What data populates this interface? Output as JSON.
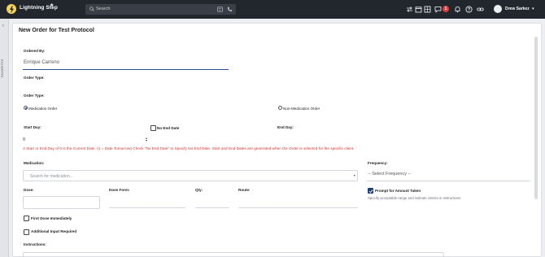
{
  "header": {
    "brand": "Lightning Step",
    "search_placeholder": "Search",
    "notification_count": "1",
    "user_name": "Drew Sarkez"
  },
  "sidebar": {
    "vertical_label": "FAVORITES"
  },
  "form": {
    "title": "New Order for Test Protocol",
    "ordered_by_label": "Ordered By:",
    "ordered_by_value": "Enrique Carreno",
    "order_type_label_1": "Order Type:",
    "order_type_label_2": "Order Type:",
    "order_type_options": [
      "Medication Order",
      "Non-Medication Order"
    ],
    "order_type_selected": "Medication Order",
    "start_day_label": "Start Day:",
    "start_day_value": "0",
    "no_end_date_label": "No End Date",
    "no_end_date_checked": false,
    "end_day_label": "End Day:",
    "warning": "A Start or End Day of 0 is the Current Date. (1 = Date Tomorrow) Check \"No End Date\" to Specify No End Date. Start and End Dates are generated when the Order is selected for the specific client.",
    "medication_label": "Medication:",
    "medication_placeholder": "Search for medication...",
    "frequency_label": "Frequency:",
    "frequency_value": "-- Select Frequency --",
    "dose_label": "Dose:",
    "dose_form_label": "Dose Form:",
    "qty_label": "Qty:",
    "route_label": "Route:",
    "prompt_amount_label": "Prompt for Amount Taken",
    "prompt_amount_checked": true,
    "prompt_amount_help": "Specify acceptable range and indicate criteria in Instructions",
    "first_dose_label": "First Dose Immediately",
    "first_dose_checked": false,
    "additional_input_label": "Additional Input Required",
    "additional_input_checked": false,
    "instructions_label": "Instructions:"
  },
  "colors": {
    "topbar": "#22262d",
    "accent": "#2e4f9a",
    "warning": "#d33030",
    "logo": "#f4d25a"
  }
}
